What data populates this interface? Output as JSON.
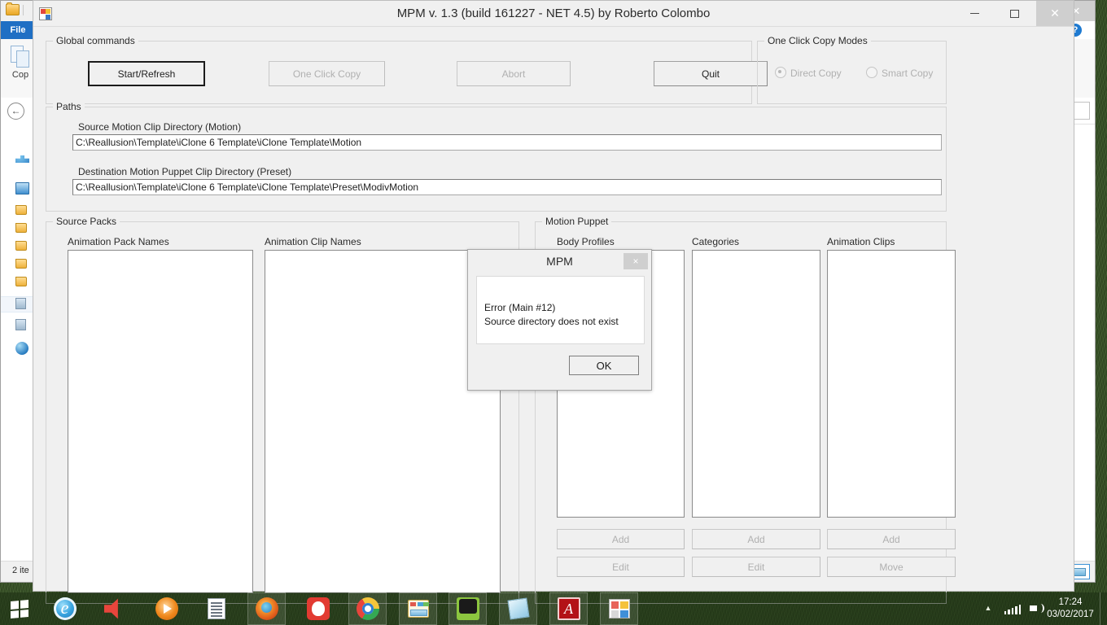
{
  "desktop": {
    "taskbar": {
      "start_label": "Start",
      "items": [
        {
          "name": "internet-explorer",
          "glyph": "gl-ie",
          "open": false
        },
        {
          "name": "volume-media",
          "glyph": "gl-speaker",
          "open": false
        },
        {
          "name": "vlc-media-player",
          "glyph": "gl-vlc",
          "open": false
        },
        {
          "name": "document-reader",
          "glyph": "gl-doc",
          "open": false
        },
        {
          "name": "mozilla-firefox",
          "glyph": "gl-firefox",
          "open": true
        },
        {
          "name": "gimp",
          "glyph": "gl-gimp",
          "open": false
        },
        {
          "name": "google-chrome",
          "glyph": "gl-chrome",
          "open": true
        },
        {
          "name": "file-explorer",
          "glyph": "gl-explorer",
          "open": true
        },
        {
          "name": "video-editor",
          "glyph": "gl-edit",
          "open": true
        },
        {
          "name": "notes-app",
          "glyph": "gl-note",
          "open": true
        },
        {
          "name": "adobe-acrobat",
          "glyph": "gl-acrobat",
          "open": true
        },
        {
          "name": "mpm-app",
          "glyph": "gl-mpm",
          "open": true
        }
      ],
      "tray": {
        "time": "17:24",
        "date": "03/02/2017"
      }
    }
  },
  "explorer": {
    "ribbon": {
      "file_tab": "File",
      "copy_label": "Cop"
    },
    "status": {
      "items_text": "2 ite"
    }
  },
  "mpm": {
    "title": "MPM v.  1.3 (build 161227 - NET 4.5) by Roberto Colombo",
    "global_commands": {
      "legend": "Global commands",
      "start_refresh": "Start/Refresh",
      "one_click_copy": "One Click Copy",
      "abort": "Abort",
      "quit": "Quit"
    },
    "one_click_copy_modes": {
      "legend": "One Click Copy Modes",
      "direct_copy": "Direct Copy",
      "smart_copy": "Smart Copy",
      "selected": "Direct Copy"
    },
    "paths": {
      "legend": "Paths",
      "source_label": "Source Motion Clip Directory (Motion)",
      "source_value": "C:\\Reallusion\\Template\\iClone 6 Template\\iClone Template\\Motion",
      "destination_label": "Destination Motion Puppet Clip Directory (Preset)",
      "destination_value": "C:\\Reallusion\\Template\\iClone 6 Template\\iClone Template\\Preset\\ModivMotion"
    },
    "source_packs": {
      "legend": "Source Packs",
      "pack_names_label": "Animation Pack Names",
      "clip_names_label": "Animation Clip Names",
      "pack_names_items": [],
      "clip_names_items": []
    },
    "motion_puppet": {
      "legend": "Motion Puppet",
      "body_profiles_label": "Body Profiles",
      "categories_label": "Categories",
      "animation_clips_label": "Animation Clips",
      "body_profiles_items": [],
      "categories_items": [],
      "animation_clips_items": [],
      "buttons": {
        "body_add": "Add",
        "body_edit": "Edit",
        "categories_add": "Add",
        "categories_edit": "Edit",
        "clips_add": "Add",
        "clips_move": "Move"
      }
    }
  },
  "dialog": {
    "title": "MPM",
    "message": "Error (Main #12)\nSource directory does not exist",
    "ok_label": "OK",
    "close_label": "×"
  },
  "colors": {
    "window_bg": "#f0f0f0",
    "accent_blue": "#1f6fc4",
    "desktop_green": "#42602f",
    "disabled_text": "#b0b0b0"
  }
}
